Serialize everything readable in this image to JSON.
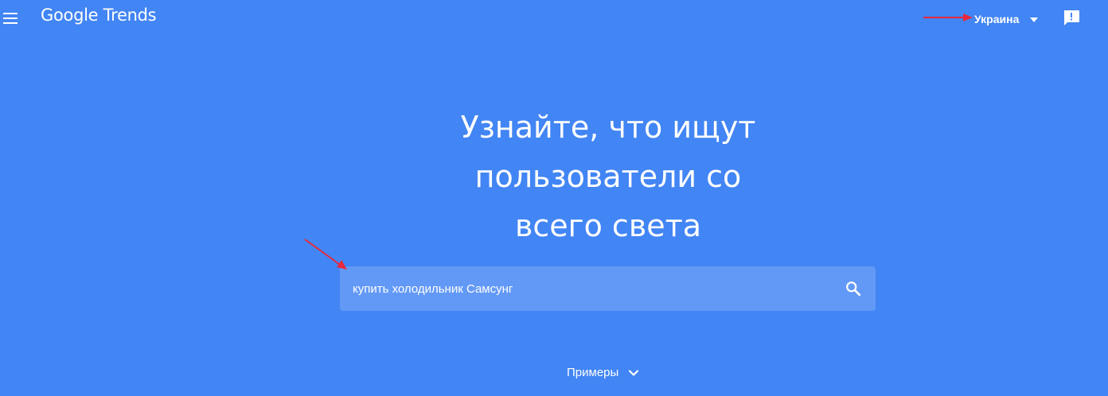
{
  "colors": {
    "background": "#4285f4",
    "search_bg": "#6399f6",
    "text": "#ffffff",
    "annotation_arrow": "#e8283c"
  },
  "header": {
    "logo_text": "Google Trends",
    "region_label": "Украина",
    "menu_icon": "hamburger-menu-icon",
    "feedback_icon": "feedback-icon"
  },
  "hero": {
    "title_lines": [
      "Узнайте, что ищут",
      "пользователи со",
      "всего света"
    ]
  },
  "search": {
    "value": "купить холодильник Самсунг",
    "icon": "search-icon"
  },
  "examples": {
    "label": "Примеры",
    "icon": "chevron-down-icon"
  }
}
